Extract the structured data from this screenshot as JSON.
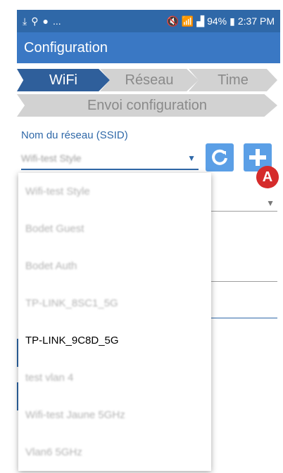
{
  "status_bar": {
    "left_icons": [
      "download-icon",
      "usb-icon",
      "notification-icon"
    ],
    "ellipsis": "...",
    "right_icons": [
      "mute-icon",
      "wifi-icon",
      "signal-icon",
      "battery-icon"
    ],
    "battery": "94%",
    "time": "2:37 PM"
  },
  "app_bar": {
    "title": "Configuration"
  },
  "steps": [
    "WiFi",
    "Réseau",
    "Time",
    "Envoi configuration"
  ],
  "ssid": {
    "label": "Nom du réseau (SSID)",
    "selected": "Wifi-test Style"
  },
  "marker": "A",
  "menu": {
    "items": [
      "Wifi-test Style",
      "Bodet Guest",
      "Bodet Auth",
      "TP-LINK_8SC1_5G",
      "TP-LINK_9C8D_5G",
      "test vlan 4",
      "Wifi-test Jaune 5GHz",
      "Vlan6 5GHz"
    ]
  },
  "colors": {
    "accent": "#2f68a8",
    "appbar": "#3a78c4",
    "active_step": "#2f5f9b",
    "marker": "#d52b2b"
  }
}
